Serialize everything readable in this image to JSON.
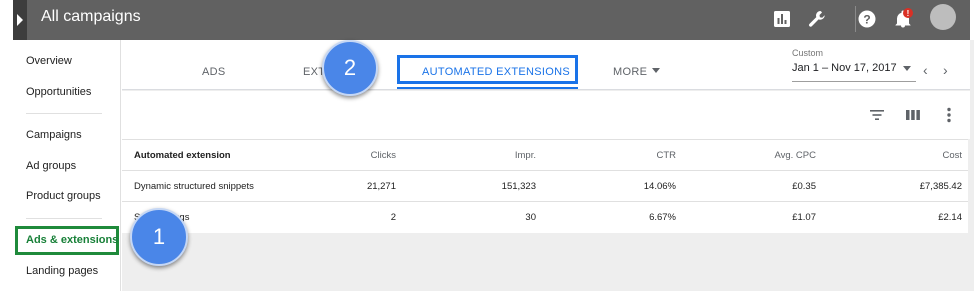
{
  "header": {
    "title": "All campaigns",
    "icons": [
      "reports-icon",
      "tools-icon",
      "help-icon",
      "notifications-icon",
      "account-avatar"
    ],
    "notification_badge": "!",
    "colors": {
      "bar": "#616161",
      "badge": "#d93025"
    }
  },
  "sidebar": {
    "items": [
      {
        "label": "Overview"
      },
      {
        "label": "Opportunities"
      },
      {
        "label": "Campaigns"
      },
      {
        "label": "Ad groups"
      },
      {
        "label": "Product groups"
      },
      {
        "label": "Ads & extensions",
        "active": true
      },
      {
        "label": "Landing pages"
      }
    ],
    "active_color": "#188038"
  },
  "tabs": [
    {
      "label": "ADS"
    },
    {
      "label": "EXTENSIONS"
    },
    {
      "label": "AUTOMATED EXTENSIONS",
      "selected": true
    },
    {
      "label": "MORE"
    }
  ],
  "date_range": {
    "label": "Custom",
    "value": "Jan 1 – Nov 17, 2017",
    "prev_glyph": "‹",
    "next_glyph": "›"
  },
  "toolbar": {
    "icons": [
      "filter-icon",
      "columns-icon",
      "more-vert-icon"
    ]
  },
  "table": {
    "columns": [
      "Automated extension",
      "Clicks",
      "Impr.",
      "CTR",
      "Avg. CPC",
      "Cost"
    ],
    "rows": [
      [
        "Dynamic structured snippets",
        "21,271",
        "151,323",
        "14.06%",
        "£0.35",
        "£7,385.42"
      ],
      [
        "Seller ratings",
        "2",
        "30",
        "6.67%",
        "£1.07",
        "£2.14"
      ]
    ]
  },
  "callouts": {
    "one": "1",
    "two": "2",
    "color": "#4a86e8"
  },
  "accent": "#1a73e8"
}
